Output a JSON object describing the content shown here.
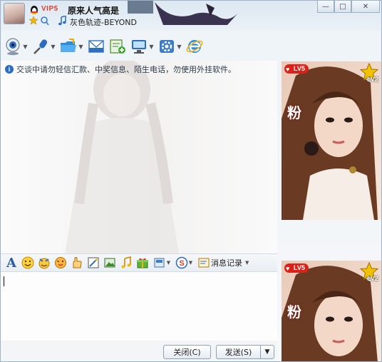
{
  "window": {
    "nickname": "原来人气高是",
    "vip_badge": "VIP5",
    "signature": "灰色轨迹-BEYOND",
    "controls": {
      "minimize": "—",
      "maximize": "□",
      "close": "✕"
    }
  },
  "toolbar": {
    "items": [
      {
        "name": "video-call",
        "icon": "webcam-icon"
      },
      {
        "name": "voice-call",
        "icon": "microphone-icon"
      },
      {
        "name": "send-file",
        "icon": "folder-icon"
      },
      {
        "name": "send-mail",
        "icon": "mail-icon"
      },
      {
        "name": "add-app",
        "icon": "add-app-icon"
      },
      {
        "name": "remote-assist",
        "icon": "remote-icon"
      },
      {
        "name": "settings",
        "icon": "gear-icon"
      },
      {
        "name": "browser",
        "icon": "ie-icon"
      }
    ]
  },
  "chat": {
    "notice": "交谈中请勿轻信汇款、中奖信息、陌生电话，勿使用外挂软件。"
  },
  "format_bar": {
    "font_label": "A",
    "history_label": "消息记录",
    "icons": [
      "font-icon",
      "smiley-icon",
      "magic-face-icon",
      "wink-icon",
      "hand-icon",
      "screenshot-icon",
      "image-icon",
      "music-icon",
      "gift-icon",
      "more-icon",
      "soso-icon"
    ]
  },
  "buttons": {
    "close": "关闭(C)",
    "send": "发送(S)",
    "send_menu": "▼"
  },
  "photos": {
    "level_badge": "LV5",
    "level_small": "LV2",
    "emblem_text": "粉"
  },
  "colors": {
    "accent_blue": "#2b6cc4",
    "badge_red": "#d9221a",
    "border": "#9fb3c8"
  }
}
